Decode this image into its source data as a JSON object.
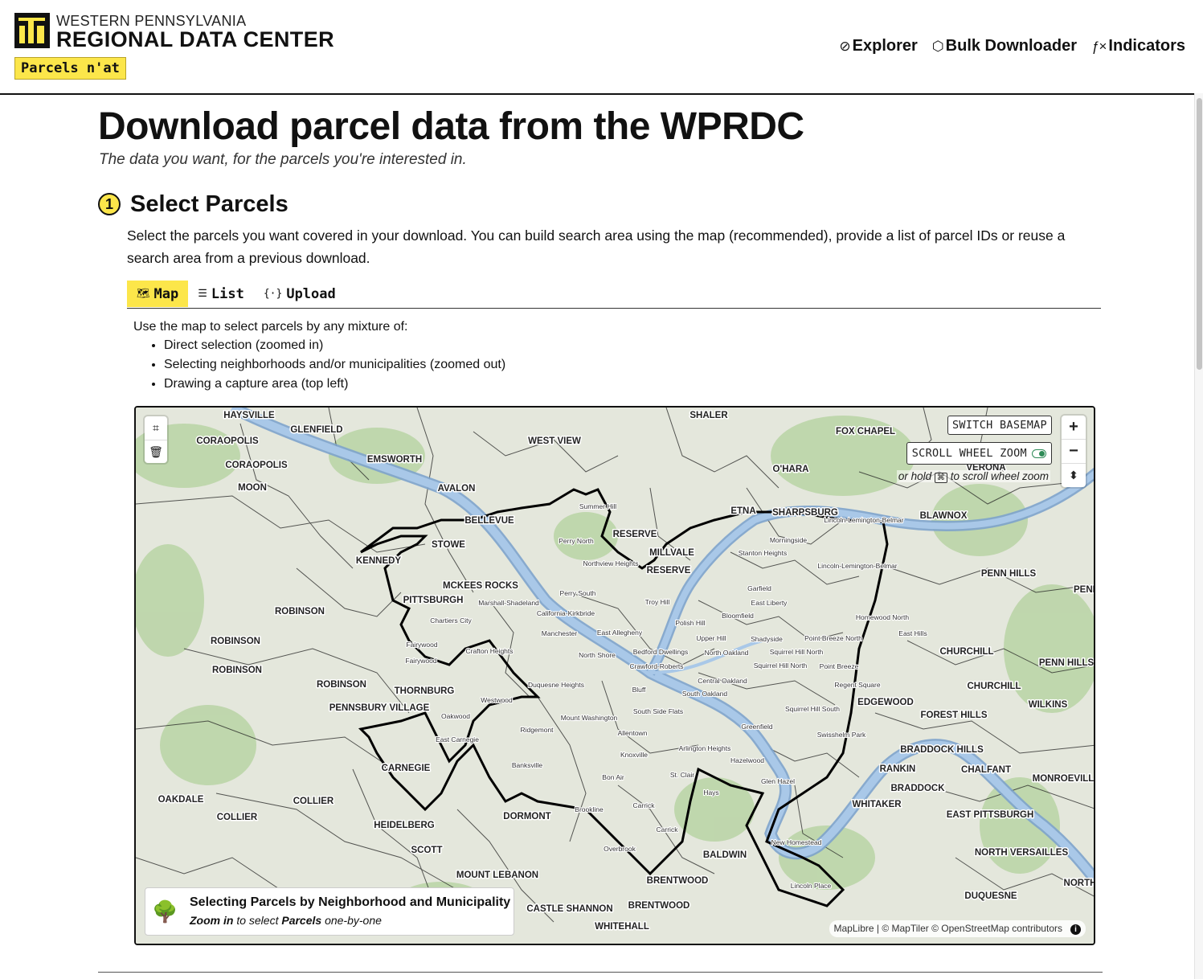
{
  "header": {
    "org_small": "WESTERN PENNSYLVANIA",
    "org_big": "REGIONAL DATA CENTER",
    "app_badge": "Parcels n'at",
    "nav": [
      {
        "label": "Explorer",
        "icon": "compass-icon"
      },
      {
        "label": "Bulk Downloader",
        "icon": "box-icon"
      },
      {
        "label": "Indicators",
        "icon": "function-icon"
      }
    ],
    "accent": "#fce64a"
  },
  "page": {
    "title": "Download parcel data from the WPRDC",
    "subtitle": "The data you want, for the parcels you're interested in."
  },
  "step": {
    "number": "1",
    "title": "Select Parcels",
    "instructions": "Select the parcels you want covered in your download. You can build search area using the map (recommended), provide a list of parcel IDs or reuse a search area from a previous download."
  },
  "tabs": [
    {
      "label": "Map",
      "icon": "map-icon",
      "active": true
    },
    {
      "label": "List",
      "icon": "list-icon",
      "active": false
    },
    {
      "label": "Upload",
      "icon": "braces-icon",
      "active": false
    }
  ],
  "map_help": {
    "intro": "Use the map to select parcels by any mixture of:",
    "bullets": [
      "Direct selection (zoomed in)",
      "Selecting neighborhoods and/or municipalities (zoomed out)",
      "Drawing a capture area (top left)"
    ]
  },
  "map": {
    "switch_basemap": "SWITCH BASEMAP",
    "scroll_zoom": "SCROLL WHEEL ZOOM",
    "scroll_hint_pre": "or hold",
    "scroll_hint_key": "⌘",
    "scroll_hint_post": "to scroll wheel zoom",
    "panel_title": "Selecting Parcels by Neighborhood and Municipality",
    "panel_sub_1": "Zoom in",
    "panel_sub_2": "to select",
    "panel_sub_3": "Parcels",
    "panel_sub_4": "one-by-one",
    "attribution": "MapLibre | © MapTiler © OpenStreetMap contributors",
    "river_color": "#a9c8e8",
    "park_color": "#b6d3a2",
    "labels": {
      "major": [
        "HAYSVILLE",
        "GLENFIELD",
        "CORAOPOLIS",
        "CORAOPOLIS",
        "MOON",
        "EMSWORTH",
        "AVALON",
        "WEST VIEW",
        "SHALER",
        "FOX CHAPEL",
        "O'HARA",
        "VERONA",
        "BELLEVUE",
        "STOWE",
        "RESERVE",
        "MILLVALE",
        "RESERVE",
        "ETNA",
        "SHARPSBURG",
        "BLAWNOX",
        "KENNEDY",
        "MCKEES ROCKS",
        "PITTSBURGH",
        "ROBINSON",
        "ROBINSON",
        "ROBINSON",
        "ROBINSON",
        "PENN HILLS",
        "PENN",
        "PENN HILLS",
        "CHURCHILL",
        "CHURCHILL",
        "WILKINS",
        "THORNBURG",
        "PENNSBURY VILLAGE",
        "CARNEGIE",
        "OAKDALE",
        "COLLIER",
        "COLLIER",
        "HEIDELBERG",
        "SCOTT",
        "MOUNT LEBANON",
        "CASTLE SHANNON",
        "BRENTWOOD",
        "BRENTWOOD",
        "WHITEHALL",
        "BALDWIN",
        "DORMONT",
        "EDGEWOOD",
        "FOREST HILLS",
        "BRADDOCK HILLS",
        "RANKIN",
        "BRADDOCK",
        "CHALFANT",
        "MONROEVILL",
        "WHITAKER",
        "EAST PITTSBURGH",
        "NORTH VERSAILLES",
        "DUQUESNE",
        "NORTH"
      ],
      "minor": [
        "Summer Hill",
        "Perry North",
        "Northview Heights",
        "Perry South",
        "Troy Hill",
        "Marshall-Shadeland",
        "California-Kirkbride",
        "Chartiers City",
        "Manchester",
        "East Allegheny",
        "Fairywood",
        "Fairywood",
        "Crafton Heights",
        "North Shore",
        "Bedford Dwellings",
        "Westwood",
        "Oakwood",
        "East Carnegie",
        "Ridgemont",
        "Banksville",
        "Duquesne Heights",
        "Mount Washington",
        "South Side Flats",
        "Allentown",
        "Knoxville",
        "Bon Air",
        "St. Clair",
        "Arlington Heights",
        "Brookline",
        "Carrick",
        "Carrick",
        "Overbrook",
        "Hays",
        "Hazelwood",
        "Glen Hazel",
        "New Homestead",
        "Lincoln Place",
        "Morningside",
        "Stanton Heights",
        "Garfield",
        "East Liberty",
        "Bloomfield",
        "Shadyside",
        "Polish Hill",
        "Upper Hill",
        "North Oakland",
        "Crawford-Roberts",
        "Central Oakland",
        "Bluff",
        "South Oakland",
        "Squirrel Hill North",
        "Squirrel Hill North",
        "Squirrel Hill South",
        "Point Breeze",
        "Point Breeze North",
        "Regent Square",
        "Homewood North",
        "East Hills",
        "Greenfield",
        "Swisshelm Park",
        "Lincoln-Lemington-Belmar",
        "Lincoln-Lemington-Belmar"
      ]
    }
  }
}
